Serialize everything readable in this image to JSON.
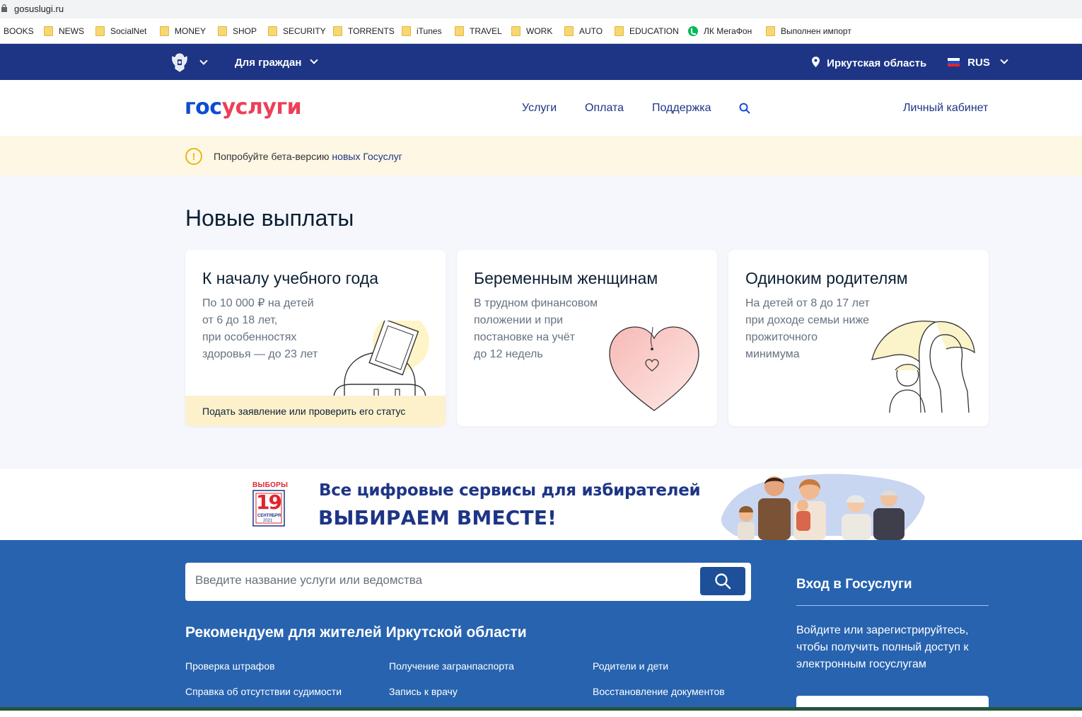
{
  "browser": {
    "url": "gosuslugi.ru",
    "bookmarks": [
      "BOOKS",
      "NEWS",
      "SocialNet",
      "MONEY",
      "SHOP",
      "SECURITY",
      "TORRENTS",
      "iTunes",
      "TRAVEL",
      "WORK",
      "AUTO",
      "EDUCATION",
      "ЛК МегаФон",
      "Выполнен импорт"
    ]
  },
  "topbar": {
    "audience": "Для граждан",
    "region": "Иркутская область",
    "language": "RUS"
  },
  "header": {
    "logo_part1": "гос",
    "logo_part2": "услуги",
    "nav": [
      "Услуги",
      "Оплата",
      "Поддержка"
    ],
    "cabinet": "Личный кабинет"
  },
  "beta": {
    "text": "Попробуйте бета-версию",
    "link": "новых Госуслуг"
  },
  "payments": {
    "title": "Новые выплаты",
    "cards": [
      {
        "title": "К началу учебного года",
        "lines": [
          "По 10 000 ₽ на детей",
          "от 6 до 18 лет,",
          "при особенностях",
          "здоровья — до 23 лет"
        ],
        "cta": "Подать заявление или проверить его статус"
      },
      {
        "title": "Беременным женщинам",
        "lines": [
          "В трудном финансовом",
          "положении и при",
          "постановке на учёт",
          "до 12 недель"
        ]
      },
      {
        "title": "Одиноким родителям",
        "lines": [
          "На детей от 8 до 17 лет",
          "при доходе семьи ниже",
          "прожиточного",
          "минимума"
        ]
      }
    ]
  },
  "banner": {
    "badge_top": "ВЫБОРЫ",
    "badge_day": "19",
    "badge_month": "СЕНТЯБРЯ",
    "badge_year": "2021",
    "line1": "Все цифровые сервисы для избирателей",
    "line2": "ВЫБИРАЕМ ВМЕСТЕ!"
  },
  "search": {
    "placeholder": "Введите название услуги или ведомства",
    "recommend_title": "Рекомендуем для жителей Иркутской области",
    "links": [
      "Проверка штрафов",
      "Получение загранпаспорта",
      "Родители и дети",
      "Справка об отсутствии судимости",
      "Запись к врачу",
      "Восстановление документов"
    ]
  },
  "login": {
    "title": "Вход в Госуслуги",
    "text": "Войдите или зарегистрируйтесь, чтобы получить полный доступ к электронным госуслугам"
  }
}
